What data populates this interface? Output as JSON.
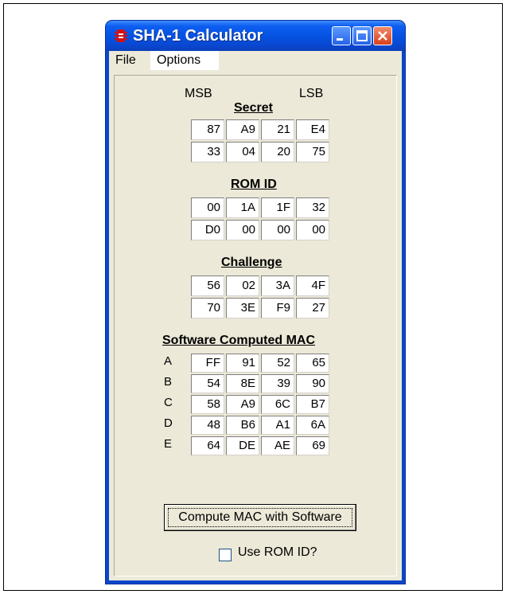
{
  "window": {
    "title": "SHA-1 Calculator",
    "icons": {
      "app": "red-chip-icon",
      "minimize": "minimize-icon",
      "maximize": "maximize-icon",
      "close": "close-icon"
    }
  },
  "menu": {
    "items": [
      "File",
      "Options"
    ]
  },
  "labels": {
    "msb": "MSB",
    "lsb": "LSB"
  },
  "secret": {
    "title": "Secret",
    "rows": [
      [
        "87",
        "A9",
        "21",
        "E4"
      ],
      [
        "33",
        "04",
        "20",
        "75"
      ]
    ]
  },
  "rom_id": {
    "title": "ROM ID",
    "rows": [
      [
        "00",
        "1A",
        "1F",
        "32"
      ],
      [
        "D0",
        "00",
        "00",
        "00"
      ]
    ]
  },
  "challenge": {
    "title": "Challenge",
    "rows": [
      [
        "56",
        "02",
        "3A",
        "4F"
      ],
      [
        "70",
        "3E",
        "F9",
        "27"
      ]
    ]
  },
  "mac": {
    "title": "Software Computed MAC",
    "row_labels": [
      "A",
      "B",
      "C",
      "D",
      "E"
    ],
    "rows": [
      [
        "FF",
        "91",
        "52",
        "65"
      ],
      [
        "54",
        "8E",
        "39",
        "90"
      ],
      [
        "58",
        "A9",
        "6C",
        "B7"
      ],
      [
        "48",
        "B6",
        "A1",
        "6A"
      ],
      [
        "64",
        "DE",
        "AE",
        "69"
      ]
    ]
  },
  "compute_button": "Compute MAC with Software",
  "use_rom_id": {
    "label": "Use ROM ID?",
    "checked": false
  }
}
